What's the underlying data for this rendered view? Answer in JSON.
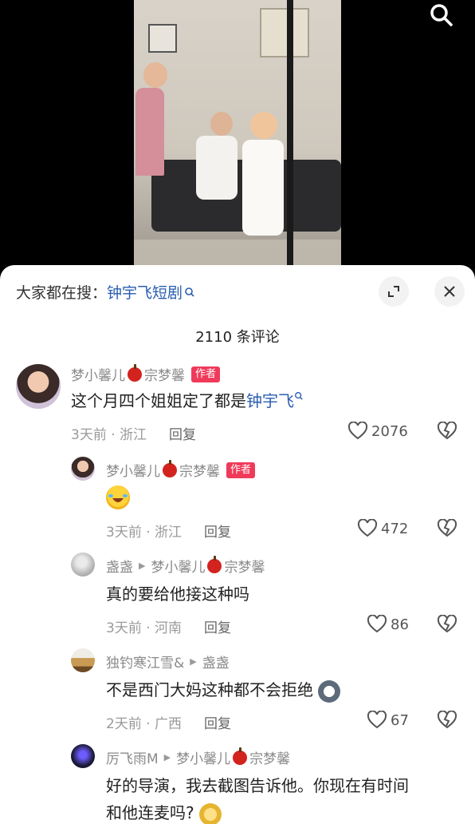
{
  "hot_search": {
    "prefix": "大家都在搜：",
    "keyword": "钟宇飞短剧"
  },
  "comment_count": "2110 条评论",
  "comments": [
    {
      "user": "梦小馨儿",
      "user_suffix": "宗梦馨",
      "tag": "作者",
      "text_prefix": "这个月四个姐姐定了都是",
      "text_keyword": "钟宇飞",
      "time": "3天前 · 浙江",
      "reply": "回复",
      "likes": "2076"
    },
    {
      "user": "梦小馨儿",
      "user_suffix": "宗梦馨",
      "tag": "作者",
      "emoji": "laugh-cry-emoji",
      "time": "3天前 · 浙江",
      "reply": "回复",
      "likes": "472"
    },
    {
      "user": "盏盏",
      "reply_to": "梦小馨儿",
      "reply_to_suffix": "宗梦馨",
      "text": "真的要给他接这种吗",
      "time": "3天前 · 河南",
      "reply": "回复",
      "likes": "86"
    },
    {
      "user": "独钓寒江雪&",
      "reply_to": "盏盏",
      "text": "不是西门大妈这种都不会拒绝",
      "time": "2天前 · 广西",
      "reply": "回复",
      "likes": "67"
    },
    {
      "user": "厉飞雨M",
      "reply_to": "梦小馨儿",
      "reply_to_suffix": "宗梦馨",
      "text_line1": "好的导演，我去截图告诉他。你现在有时间",
      "text_line2": "和他连麦吗?"
    }
  ],
  "colors": {
    "accent_link": "#2a5db0",
    "author_tag": "#f03a5a",
    "apple": "#d2231f"
  }
}
